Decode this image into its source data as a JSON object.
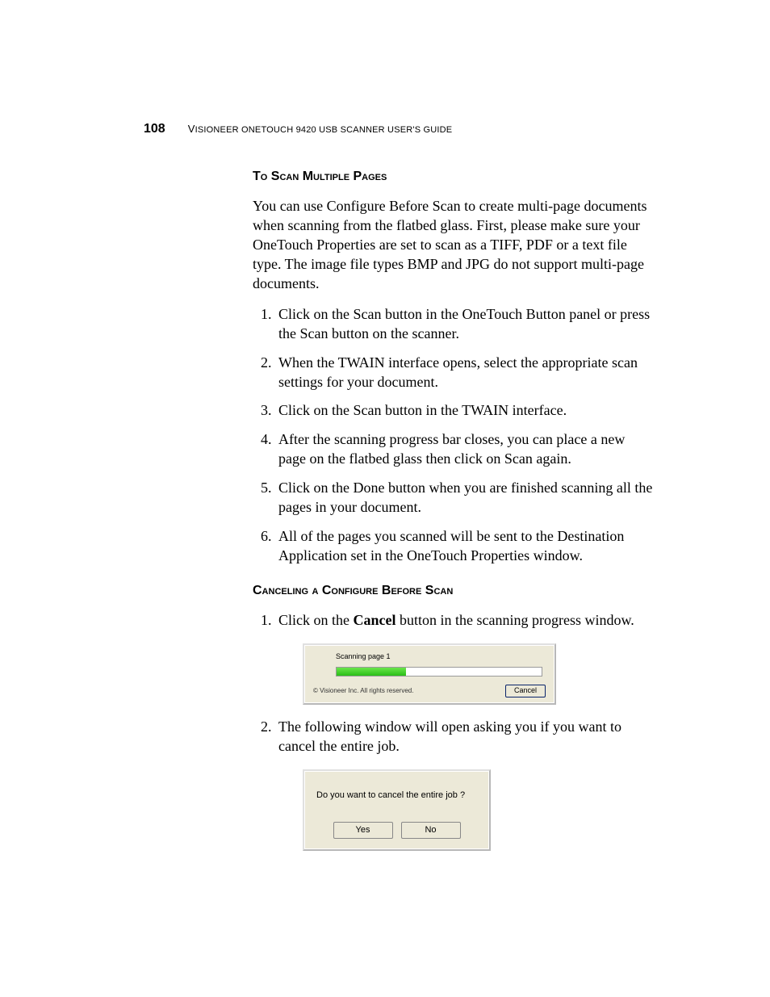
{
  "header": {
    "page_number": "108",
    "title_prefix": "V",
    "title_rest": "ISIONEER ONETOUCH 9420 USB SCANNER USER'S GUIDE"
  },
  "section1": {
    "heading": "To Scan Multiple Pages",
    "intro": "You can use Configure Before Scan to create multi-page documents when scanning from the flatbed glass. First, please make sure your OneTouch Properties are set to scan as a TIFF, PDF or a text file type. The image file types BMP and JPG do not support multi-page documents.",
    "steps": [
      "Click on the Scan button in the OneTouch Button panel or press the Scan button on the scanner.",
      "When the TWAIN interface opens, select the appropriate scan settings for your document.",
      "Click on the Scan button in the TWAIN interface.",
      "After the scanning progress bar closes, you can place a new page on the flatbed glass then click on Scan again.",
      "Click on the Done button when you are finished scanning all the pages in your document.",
      "All of the pages you scanned will be sent to the Destination Application set in the OneTouch Properties window."
    ]
  },
  "section2": {
    "heading": "Canceling a Configure Before Scan",
    "step1_prefix": "Click on the ",
    "step1_bold": "Cancel",
    "step1_suffix": " button in the scanning progress window.",
    "progress_dialog": {
      "label": "Scanning page 1",
      "copyright": "© Visioneer Inc. All rights reserved.",
      "cancel": "Cancel"
    },
    "step2": "The following window will open asking you if you want to cancel the entire job.",
    "confirm_dialog": {
      "message": "Do you want to cancel the entire job ?",
      "yes": "Yes",
      "no": "No"
    }
  }
}
